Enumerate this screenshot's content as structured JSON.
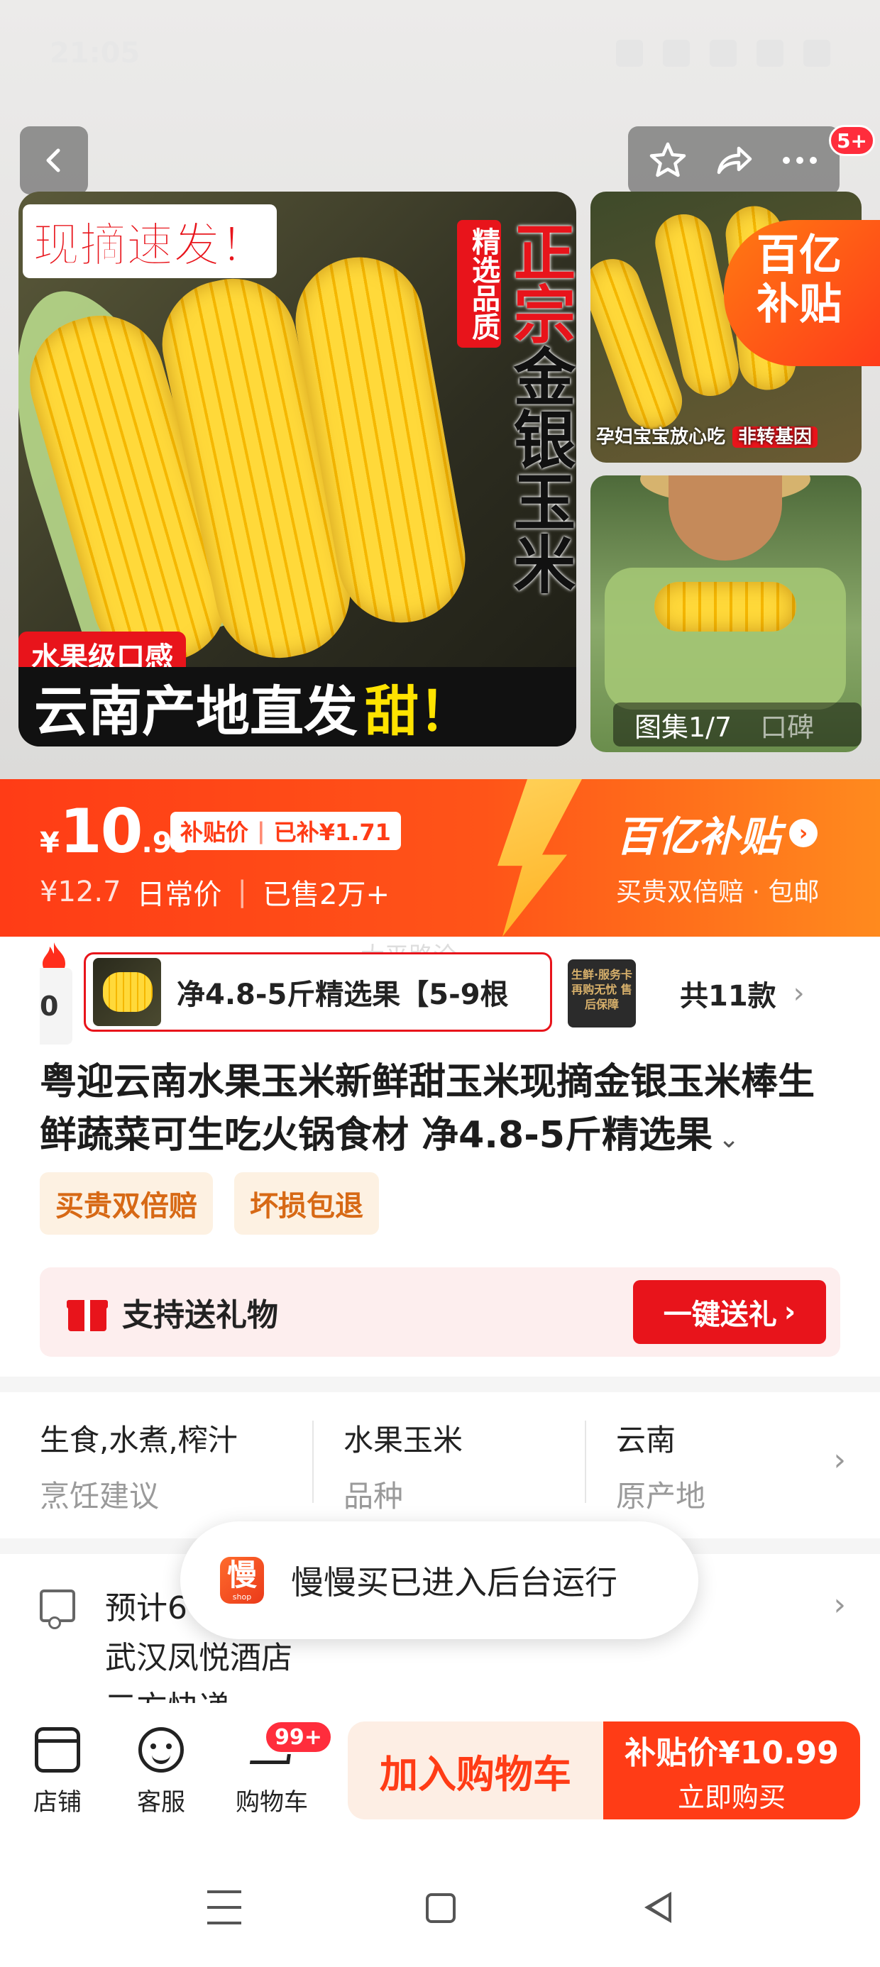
{
  "status_bar": {
    "time": "21:05"
  },
  "gallery": {
    "badge": "5+",
    "main_photo": {
      "headline": "现摘速发！",
      "tag_quality": "精选品质",
      "vertical_title_red": "正宗",
      "vertical_title": "金银玉米",
      "fruit_tag": "水果级口感",
      "bottom_line": "云南产地直发",
      "bottom_sweet": "甜！"
    },
    "thumb1": {
      "subsidy_corner": "百亿补贴",
      "caption": "孕妇宝宝放心吃",
      "caption_pill": "非转基因"
    },
    "counter": {
      "label": "图集1/7",
      "reviews": "口碑"
    }
  },
  "price": {
    "yen": "¥",
    "integer": "10",
    "decimal": ".99",
    "subsidy_pill_left": "补贴价",
    "subsidy_pill_right": "已补¥1.71",
    "original": "¥12.7",
    "original_label": "日常价",
    "sold": "已售2万+",
    "brand": "百亿补贴",
    "brand_sub": "买贵双倍赔 · 包邮"
  },
  "variants": {
    "ghost": "大平路沧",
    "left_stub": "0",
    "selected_label": "净4.8-5斤精选果【5-9根",
    "second_thumb_text": "生鲜·服务卡 再购无忧 售后保障",
    "total": "共11款"
  },
  "product": {
    "title": "粤迎云南水果玉米新鲜甜玉米现摘金银玉米棒生鲜蔬菜可生吃火锅食材 净4.8-5斤精选果",
    "tags": [
      "买贵双倍赔",
      "坏损包退"
    ]
  },
  "gift": {
    "text": "支持送礼物",
    "button": "一键送礼"
  },
  "attributes": [
    {
      "value": "生食,水煮,榨汁",
      "key": "烹饪建议"
    },
    {
      "value": "水果玉米",
      "key": "品种"
    },
    {
      "value": "云南",
      "key": "原产地"
    }
  ],
  "delivery": {
    "line1": "预计6",
    "line2": "武汉凤悦酒店",
    "line3": "三方快递"
  },
  "toast": {
    "logo": "慢",
    "logo_sub": "shop",
    "text": "慢慢买已进入后台运行"
  },
  "bottom_bar": {
    "store": "店铺",
    "service": "客服",
    "cart": "购物车",
    "cart_badge": "99+",
    "add_cart": "加入购物车",
    "buy_price": "补贴价¥10.99",
    "buy_now": "立即购买"
  },
  "colors": {
    "accent": "#ff3c16",
    "red": "#e8141b",
    "tag_orange": "#d76915"
  }
}
